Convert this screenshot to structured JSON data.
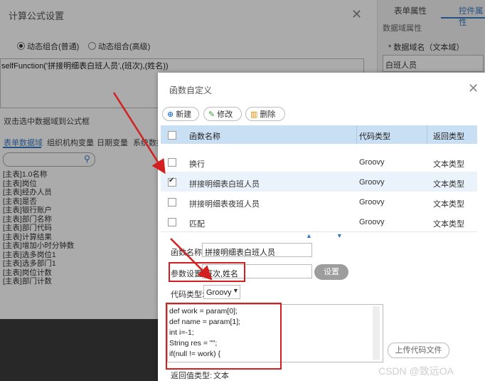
{
  "background_dialog": {
    "title": "计算公式设置",
    "radio_options": [
      "动态组合(普通)",
      "动态组合(高级)"
    ],
    "selected_radio": 0,
    "formula": "selfFunction('拼接明细表白班人员',(班次),(姓名))",
    "hint": "双击选中数据域到公式框",
    "tabs": [
      "表单数据域",
      "组织机构变量",
      "日期变量",
      "系统数据"
    ],
    "active_tab": 0,
    "search_placeholder": "",
    "field_items": [
      "[主表]1.0名称",
      "[主表]岗位",
      "[主表]经办人员",
      "[主表]是否",
      "[主表]银行账户",
      "[主表]部门名称",
      "[主表]部门代码",
      "[主表]计算结果",
      "[主表]增加小时分钟数",
      "[主表]选多岗位1",
      "[主表]选多部门1",
      "[主表]岗位计数",
      "[主表]部门计数"
    ]
  },
  "right_panel": {
    "tabs": [
      "表单属性",
      "控件属性"
    ],
    "section": "数据域属性",
    "field_label": "* 数据域名（文本域）",
    "field_value": "白班人员"
  },
  "modal": {
    "title": "函数自定义",
    "toolbar": [
      {
        "label": "新建",
        "icon": "plus-icon",
        "icon_glyph": "+",
        "color": "#2f7bd0"
      },
      {
        "label": "修改",
        "icon": "edit-icon",
        "icon_glyph": "✎",
        "color": "#3a9a3a"
      },
      {
        "label": "删除",
        "icon": "trash-icon",
        "icon_glyph": "🗑",
        "color": "#d88a00"
      }
    ],
    "columns": [
      "函数名称",
      "代码类型",
      "返回类型"
    ],
    "rows": [
      {
        "name": "换行",
        "code_type": "Groovy",
        "return_type": "文本类型",
        "checked": false
      },
      {
        "name": "拼接明细表白班人员",
        "code_type": "Groovy",
        "return_type": "文本类型",
        "checked": true
      },
      {
        "name": "拼接明细表夜班人员",
        "code_type": "Groovy",
        "return_type": "文本类型",
        "checked": false
      },
      {
        "name": "匹配",
        "code_type": "Groovy",
        "return_type": "文本类型",
        "checked": false
      }
    ],
    "form": {
      "name_label": "函数名称:",
      "name_value": "拼接明细表白班人员",
      "params_label": "参数设置:",
      "params_value": "班次,姓名",
      "set_button": "设置",
      "code_type_label": "代码类型:",
      "code_type_value": "Groovy",
      "code_lines": [
        "def work = param[0];",
        "def name = param[1];",
        "int i=-1;",
        "String res = \"\";",
        "if(null != work) {"
      ],
      "upload_button": "上传代码文件",
      "return_label": "返回值类型:",
      "return_value": "文本"
    }
  },
  "watermark": "CSDN @致远OA",
  "colors": {
    "accent": "#3a7ac4",
    "annotation_red": "#d21f1f",
    "header_blue": "#c9dff3"
  }
}
